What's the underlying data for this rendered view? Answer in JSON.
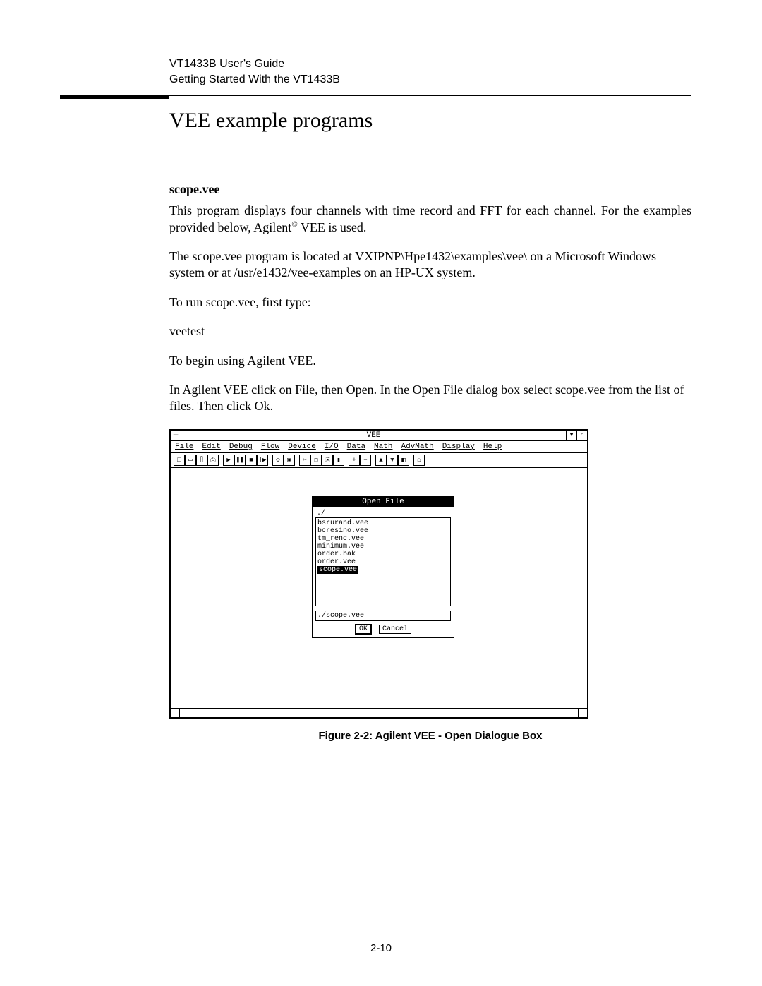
{
  "header": {
    "line1": "VT1433B User's Guide",
    "line2": "Getting Started With the VT1433B"
  },
  "section_title": "VEE example programs",
  "subhead": "scope.vee",
  "para1a": "This program displays four channels with time record and FFT for each channel. For the examples provided below, Agilent",
  "para1_sup": "©",
  "para1b": " VEE is used.",
  "para2": "The scope.vee program is located at VXIPNP\\Hpe1432\\examples\\vee\\ on a Microsoft Windows system or at /usr/e1432/vee-examples on an HP-UX system.",
  "para3": "To run scope.vee, first type:",
  "para4": "veetest",
  "para5": "To begin using Agilent VEE.",
  "para6": "In Agilent VEE click on File, then Open. In the Open File dialog box select scope.vee from the list of files.  Then click Ok.",
  "figure_caption": "Figure 2-2:  Agilent VEE - Open Dialogue Box",
  "page_number": "2-10",
  "vee": {
    "title": "VEE",
    "sysmenu": "—",
    "min": "▾",
    "max": "▫",
    "menu": [
      "File",
      "Edit",
      "Debug",
      "Flow",
      "Device",
      "I/O",
      "Data",
      "Math",
      "AdvMath",
      "Display",
      "Help"
    ],
    "openfile": {
      "title": "Open File",
      "header": "./",
      "items": [
        "bsrurand.vee",
        "bcresino.vee",
        "tm_renc.vee",
        "minimum.vee",
        "order.bak",
        "order.vee",
        "scope.vee"
      ],
      "selected_index": 6,
      "input": "./scope.vee",
      "ok": "OK",
      "cancel": "Cancel"
    }
  }
}
